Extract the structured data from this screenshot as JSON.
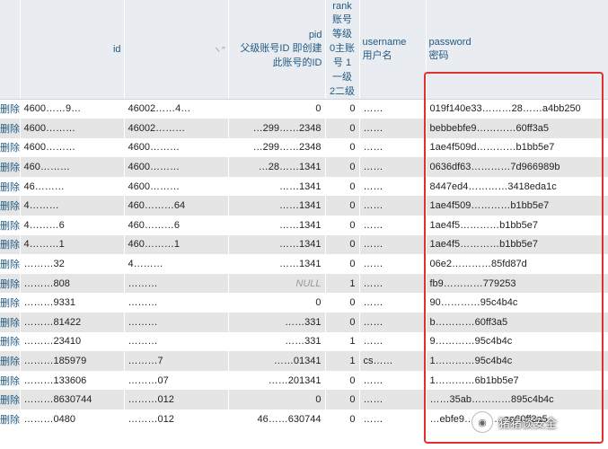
{
  "headers": {
    "id": "id",
    "col3": "ヽ″",
    "pid_name": "pid",
    "pid_desc": "父级账号ID 即创建此账号的ID",
    "rank_name": "rank",
    "rank_desc": "账号等级 0主账号 1一级 2二级",
    "username_name": "username",
    "username_desc": "用户名",
    "password_name": "password",
    "password_desc": "密码"
  },
  "delete_label": "删除",
  "rows": [
    {
      "id": "4600……9…",
      "col3": "46002……4…",
      "pid": "0",
      "rank": "0",
      "username": "……",
      "password": "019f140e33………28……a4bb250"
    },
    {
      "id": "4600………",
      "col3": "46002………",
      "pid": "…299……2348",
      "rank": "0",
      "username": "……",
      "password": "bebbebfe9…………60ff3a5"
    },
    {
      "id": "4600………",
      "col3": "4600………",
      "pid": "…299……2348",
      "rank": "0",
      "username": "……",
      "password": "1ae4f509d…………b1bb5e7"
    },
    {
      "id": "460………",
      "col3": "4600………",
      "pid": "…28……1341",
      "rank": "0",
      "username": "……",
      "password": "0636df63…………7d966989b"
    },
    {
      "id": "46………",
      "col3": "4600………",
      "pid": "……1341",
      "rank": "0",
      "username": "……",
      "password": "8447ed4…………3418eda1c"
    },
    {
      "id": "4………",
      "col3": "460………64",
      "pid": "……1341",
      "rank": "0",
      "username": "……",
      "password": "1ae4f509…………b1bb5e7"
    },
    {
      "id": "4………6",
      "col3": "460………6",
      "pid": "……1341",
      "rank": "0",
      "username": "……",
      "password": "1ae4f5…………b1bb5e7"
    },
    {
      "id": "4………1",
      "col3": "460………1",
      "pid": "……1341",
      "rank": "0",
      "username": "……",
      "password": "1ae4f5…………b1bb5e7"
    },
    {
      "id": "………32",
      "col3": "4………",
      "pid": "……1341",
      "rank": "0",
      "username": "……",
      "password": "06e2…………85fd87d"
    },
    {
      "id": "………808",
      "col3": "………",
      "pid": "NULL",
      "rank": "1",
      "username": "……",
      "password": "fb9…………779253"
    },
    {
      "id": "………9331",
      "col3": "………",
      "pid": "0",
      "rank": "0",
      "username": "……",
      "password": "90…………95c4b4c"
    },
    {
      "id": "………81422",
      "col3": "………",
      "pid": "……331",
      "rank": "0",
      "username": "……",
      "password": "b…………60ff3a5"
    },
    {
      "id": "………23410",
      "col3": "………",
      "pid": "……331",
      "rank": "1",
      "username": "……",
      "password": "9…………95c4b4c"
    },
    {
      "id": "………185979",
      "col3": "………7",
      "pid": "……01341",
      "rank": "1",
      "username": "cs……",
      "password": "1…………95c4b4c"
    },
    {
      "id": "………133606",
      "col3": "………07",
      "pid": "……201341",
      "rank": "0",
      "username": "……",
      "password": "1…………6b1bb5e7"
    },
    {
      "id": "………8630744",
      "col3": "………012",
      "pid": "0",
      "rank": "0",
      "username": "……",
      "password": "……35ab…………895c4b4c"
    },
    {
      "id": "………0480",
      "col3": "………012",
      "pid": "46……630744",
      "rank": "0",
      "username": "……",
      "password": "…ebfe9…………aa60ff3a5"
    }
  ],
  "watermark": "猪猪谈安全"
}
